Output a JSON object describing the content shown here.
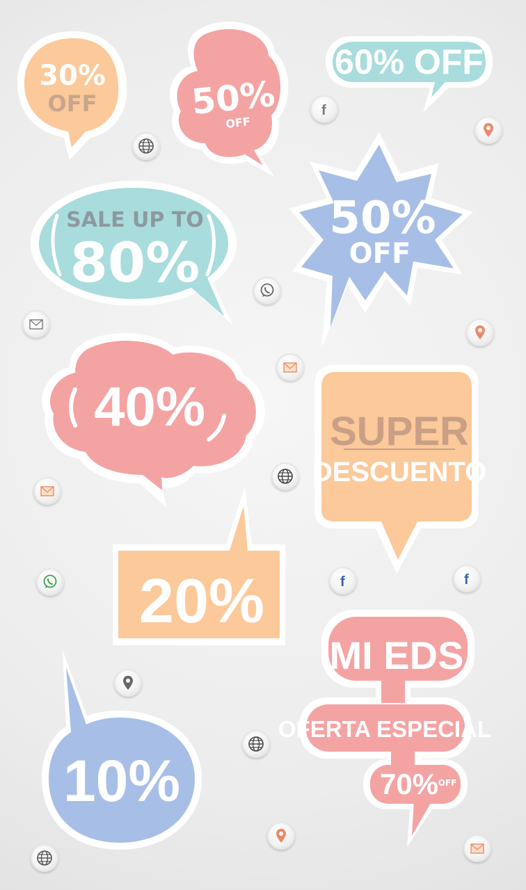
{
  "badges": {
    "b30": {
      "big": "30%",
      "small": "OFF"
    },
    "b50a": {
      "big": "50%",
      "small": "OFF"
    },
    "b60": {
      "text": "60% OFF"
    },
    "b80": {
      "top": "SALE UP TO",
      "big": "80%"
    },
    "b50b": {
      "big": "50%",
      "small": "OFF"
    },
    "b40": {
      "big": "40%"
    },
    "super": {
      "top": "SUPER",
      "bottom": "DESCUENTO"
    },
    "b20": {
      "big": "20%"
    },
    "mieds": {
      "title": "MI EDS",
      "sub": "OFERTA ESPECIAL",
      "pct": "70%",
      "off": "OFF"
    },
    "b10": {
      "big": "10%"
    }
  },
  "colors": {
    "orange": "#fbc99a",
    "pink": "#f4a3a3",
    "teal": "#a9dcdc",
    "blue": "#a7bfe6",
    "white": "#ffffff",
    "grayText": "#8c9aa0",
    "brownText": "#c99f86"
  },
  "icons": [
    "globe-icon",
    "facebook-icon",
    "location-pin-icon",
    "whatsapp-icon",
    "mail-icon"
  ]
}
